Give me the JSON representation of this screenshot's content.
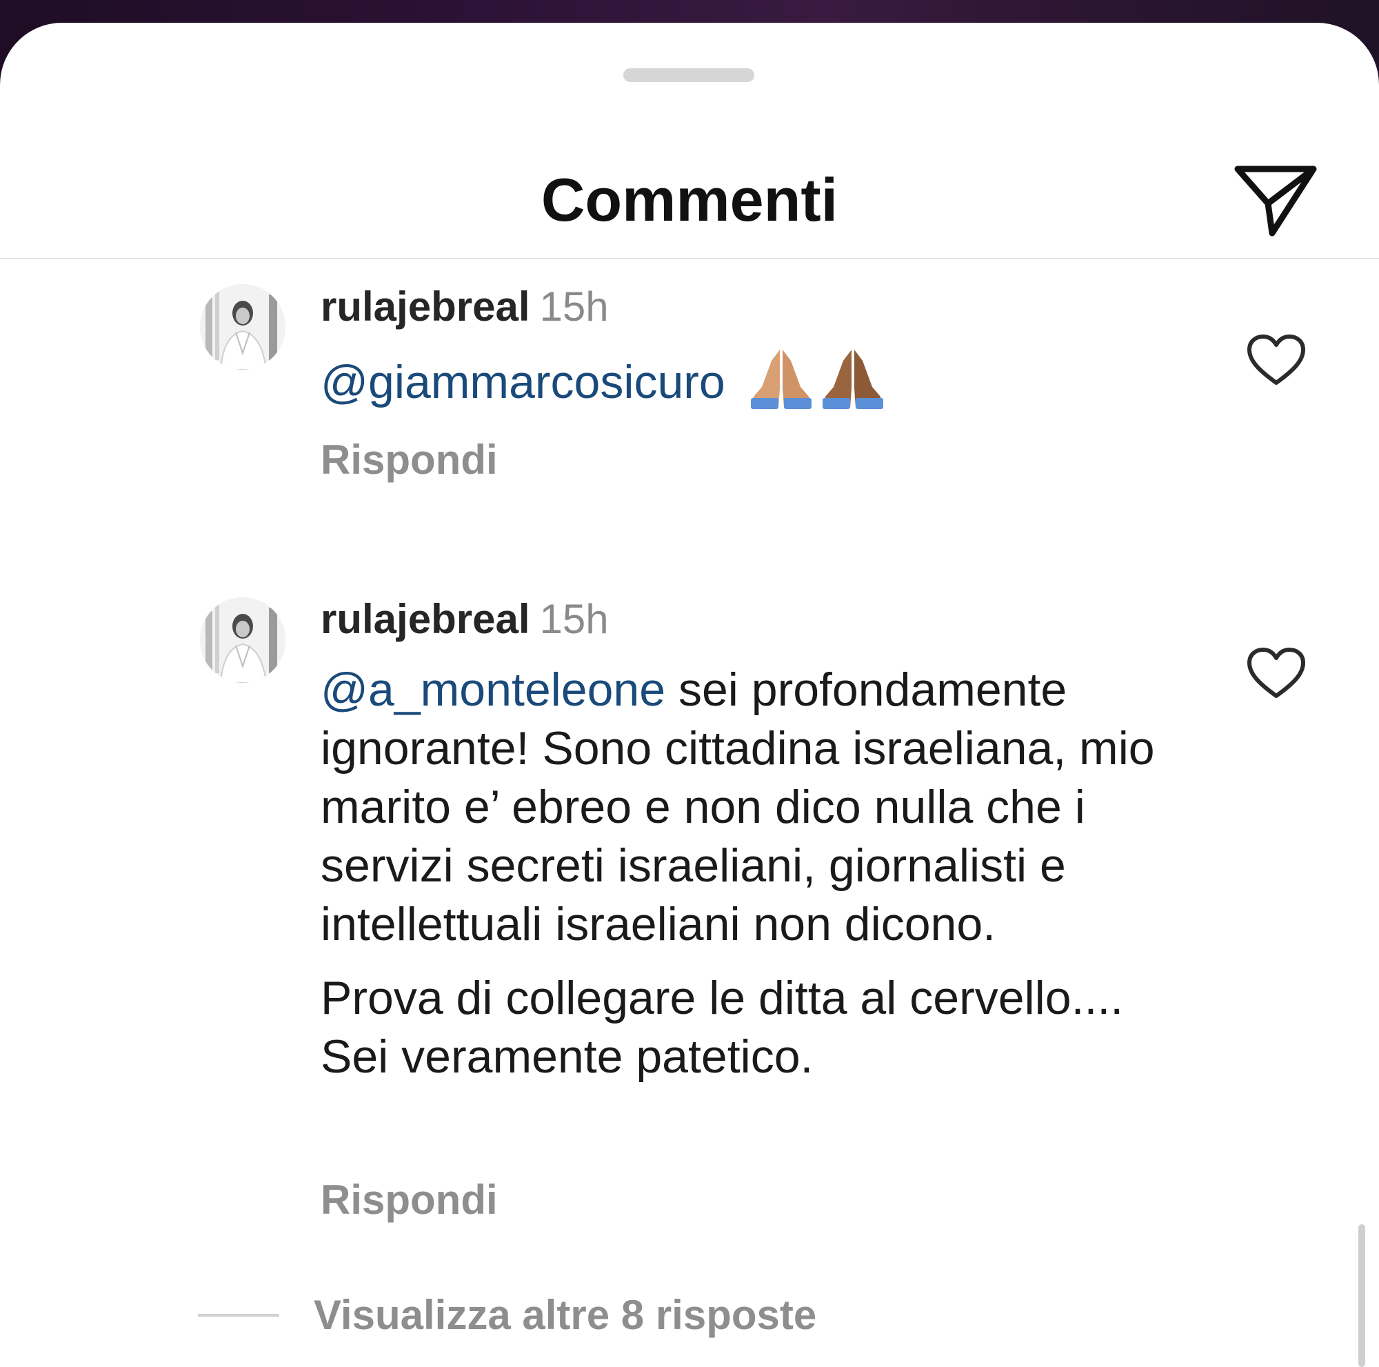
{
  "header": {
    "title": "Commenti",
    "send_icon": "paper-plane-icon"
  },
  "comments": [
    {
      "username": "rulajebreal",
      "time": "15h",
      "mention": "@giammarcosicuro",
      "text": "",
      "emoji": [
        "folded-hands-medium-skin",
        "folded-hands-dark-skin"
      ],
      "reply_label": "Rispondi",
      "like_icon": "heart-outline-icon"
    },
    {
      "username": "rulajebreal",
      "time": "15h",
      "mention": "@a_monteleone",
      "text": " sei profondamente ignorante! Sono cittadina israeliana, mio marito e’ ebreo e non dico nulla che i servizi secreti israeliani, giornalisti e intellettuali israeliani non dicono.",
      "text2": "Prova di collegare le ditta al cervello.... Sei veramente patetico.",
      "reply_label": "Rispondi",
      "like_icon": "heart-outline-icon"
    }
  ],
  "view_more": "Visualizza altre 8 risposte",
  "colors": {
    "mention": "#1a4a7a",
    "secondary_text": "#8e8e8e",
    "primary_text": "#1a1a1a"
  }
}
